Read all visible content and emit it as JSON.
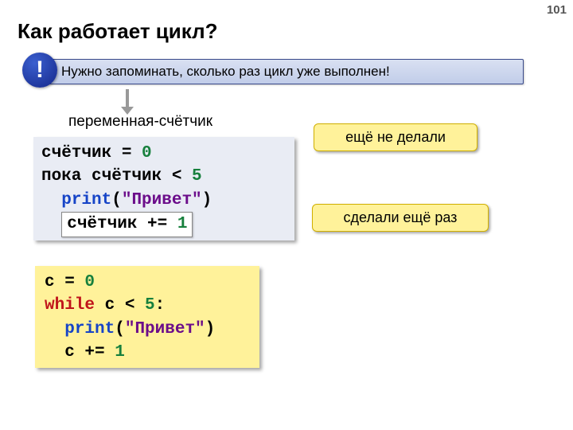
{
  "page_number": "101",
  "title": "Как работает цикл?",
  "note_icon": "!",
  "note_text": "Нужно запоминать, сколько раз цикл уже выполнен!",
  "counter_label": "переменная-счётчик",
  "pseudo": {
    "line1_a": "счётчик = ",
    "line1_b": "0",
    "line2_a": "пока счётчик < ",
    "line2_b": "5",
    "line3_a": "print",
    "line3_b": "(",
    "line3_c": "\"Привет\"",
    "line3_d": ")",
    "line4_a": "счётчик += ",
    "line4_b": "1"
  },
  "callout1": "ещё не делали",
  "callout2": "сделали ещё раз",
  "python": {
    "line1_a": "c",
    "line1_b": " = ",
    "line1_c": "0",
    "line2_a": "while",
    "line2_b": " c < ",
    "line2_c": "5",
    "line2_d": ":",
    "line3_a": "print",
    "line3_b": "(",
    "line3_c": "\"Привет\"",
    "line3_d": ")",
    "line4_a": "c",
    "line4_b": " += ",
    "line4_c": "1"
  }
}
